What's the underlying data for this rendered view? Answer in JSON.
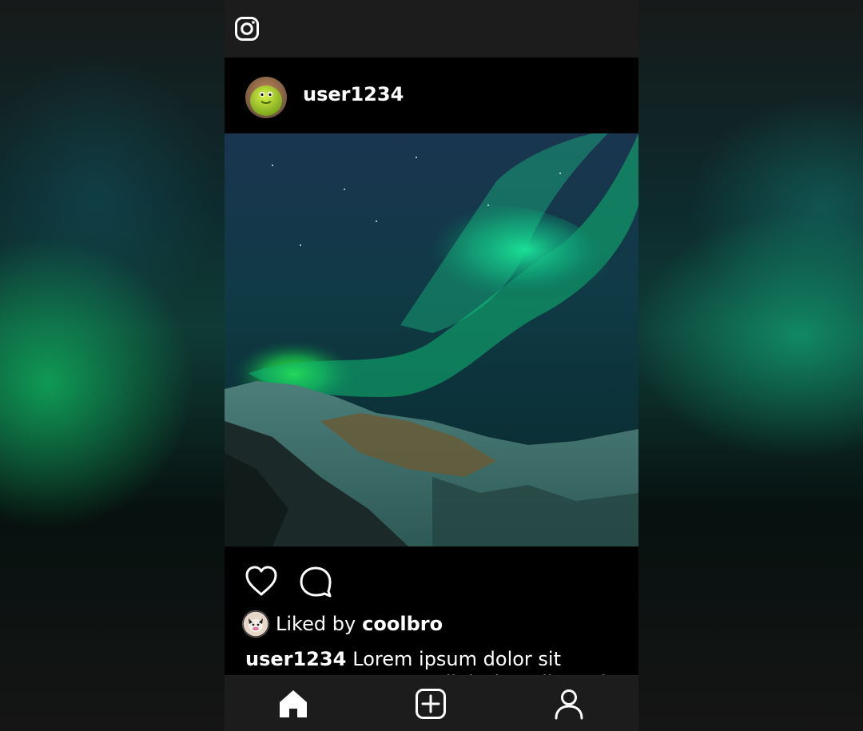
{
  "app": {
    "logo_icon": "instagram-icon"
  },
  "post": {
    "username": "user1234",
    "avatar_icon": "green-creature-avatar",
    "photo_subject": "aurora-over-snowy-mountains",
    "liked_by_prefix": "Liked by",
    "liked_by_user": "coolbro",
    "caption_user": "user1234",
    "caption_text": "Lorem ipsum dolor sit amet, consectetur adipiscing elit, sed"
  },
  "actions": {
    "like_icon": "heart-icon",
    "comment_icon": "comment-icon"
  },
  "nav": {
    "items": [
      {
        "name": "home",
        "icon": "home-icon"
      },
      {
        "name": "add",
        "icon": "add-post-icon"
      },
      {
        "name": "profile",
        "icon": "user-icon"
      }
    ]
  },
  "colors": {
    "bar_bg": "#1c1c1c",
    "content_bg": "#000000",
    "text": "#ffffff",
    "aurora_green": "#1fd37a"
  }
}
